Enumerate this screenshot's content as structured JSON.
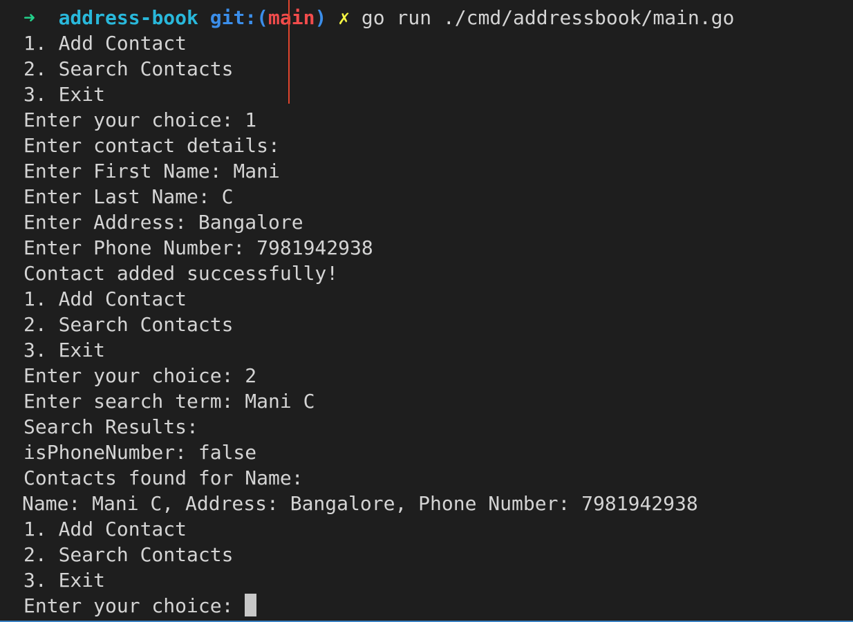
{
  "prompt": {
    "arrow": "➜",
    "directory": "address-book",
    "git_label": "git:(",
    "branch": "main",
    "git_close": ")",
    "dirty_mark": "✗",
    "command": "go run ./cmd/addressbook/main.go"
  },
  "output_lines": [
    "1. Add Contact",
    "2. Search Contacts",
    "3. Exit",
    "Enter your choice: 1",
    "Enter contact details:",
    "Enter First Name: Mani",
    "Enter Last Name: C",
    "Enter Address: Bangalore",
    "Enter Phone Number: 7981942938",
    "Contact added successfully!",
    "1. Add Contact",
    "2. Search Contacts",
    "3. Exit",
    "Enter your choice: 2",
    "Enter search term: Mani C",
    "Search Results:",
    "isPhoneNumber: false",
    "Contacts found for Name:",
    "Name: Mani C, Address: Bangalore, Phone Number: 7981942938",
    "1. Add Contact",
    "2. Search Contacts",
    "3. Exit"
  ],
  "current_input": {
    "prompt_text": "Enter your choice: ",
    "value": ""
  },
  "colors": {
    "background": "#1e1e1e",
    "text": "#d4d4d4",
    "arrow": "#23d18b",
    "directory": "#29b8db",
    "git": "#3b8eea",
    "branch": "#f14c4c",
    "dirty": "#f5f543"
  }
}
